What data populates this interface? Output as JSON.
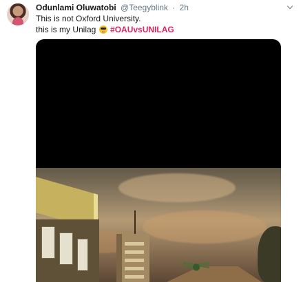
{
  "tweet": {
    "author_name": "Odunlami Oluwatobi",
    "author_handle": "@Teegyblink",
    "time": "2h",
    "separator": "·",
    "line1": "This is not Oxford University.",
    "line2_prefix": "this is my Unilag",
    "hashtag": "#OAUvsUNILAG",
    "emoji": "sunglasses-face",
    "hashtag_color": "#e0245e"
  },
  "icons": {
    "avatar": "profile-avatar",
    "menu": "chevron-down-icon",
    "media": "campus-photo"
  }
}
